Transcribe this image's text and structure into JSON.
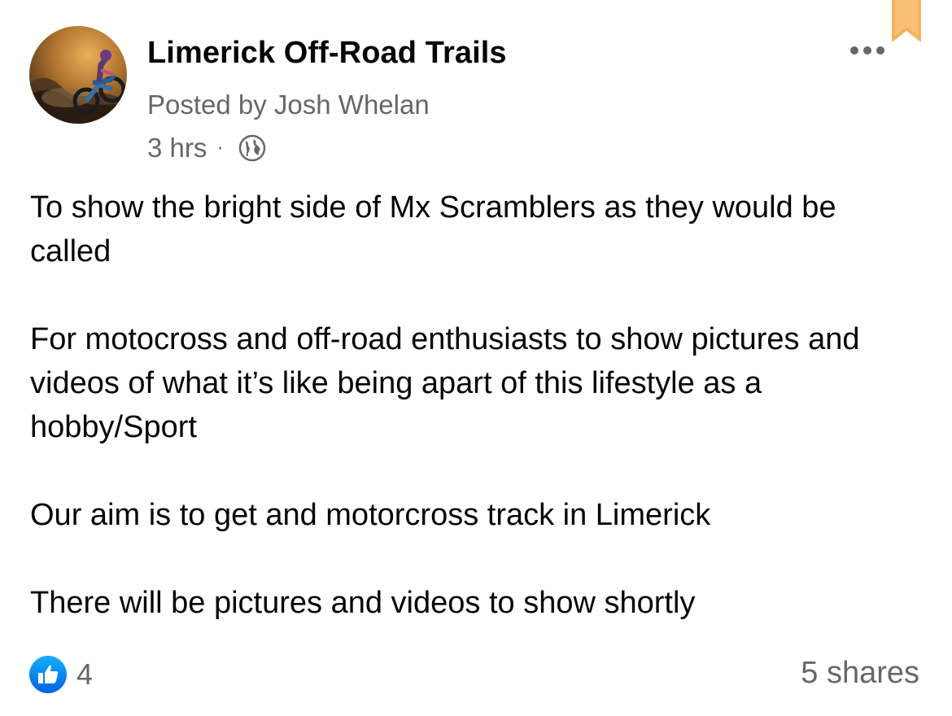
{
  "post": {
    "page_name": "Limerick Off-Road Trails",
    "posted_by": "Posted by Josh Whelan",
    "time": "3 hrs",
    "separator": "·",
    "privacy_icon": "globe-icon",
    "avatar_icon": "motocross-rider-avatar",
    "menu_icon": "more-options-icon",
    "bookmark_icon": "bookmark-ribbon-icon",
    "paragraphs": [
      "To show the bright side of Mx Scramblers as they would be called",
      "For motocross and off-road enthusiasts to show pictures and videos of what it’s like being apart of this lifestyle as a hobby/Sport",
      "Our aim is to get and motorcross track in Limerick",
      "There will be pictures and videos to show shortly"
    ]
  },
  "footer": {
    "reaction_icon": "like-icon",
    "reaction_count": "4",
    "shares": "5 shares"
  },
  "colors": {
    "text_primary": "#050505",
    "text_secondary": "#65676b",
    "like_blue": "#1877f2",
    "bookmark_gold": "#f4b35a"
  }
}
